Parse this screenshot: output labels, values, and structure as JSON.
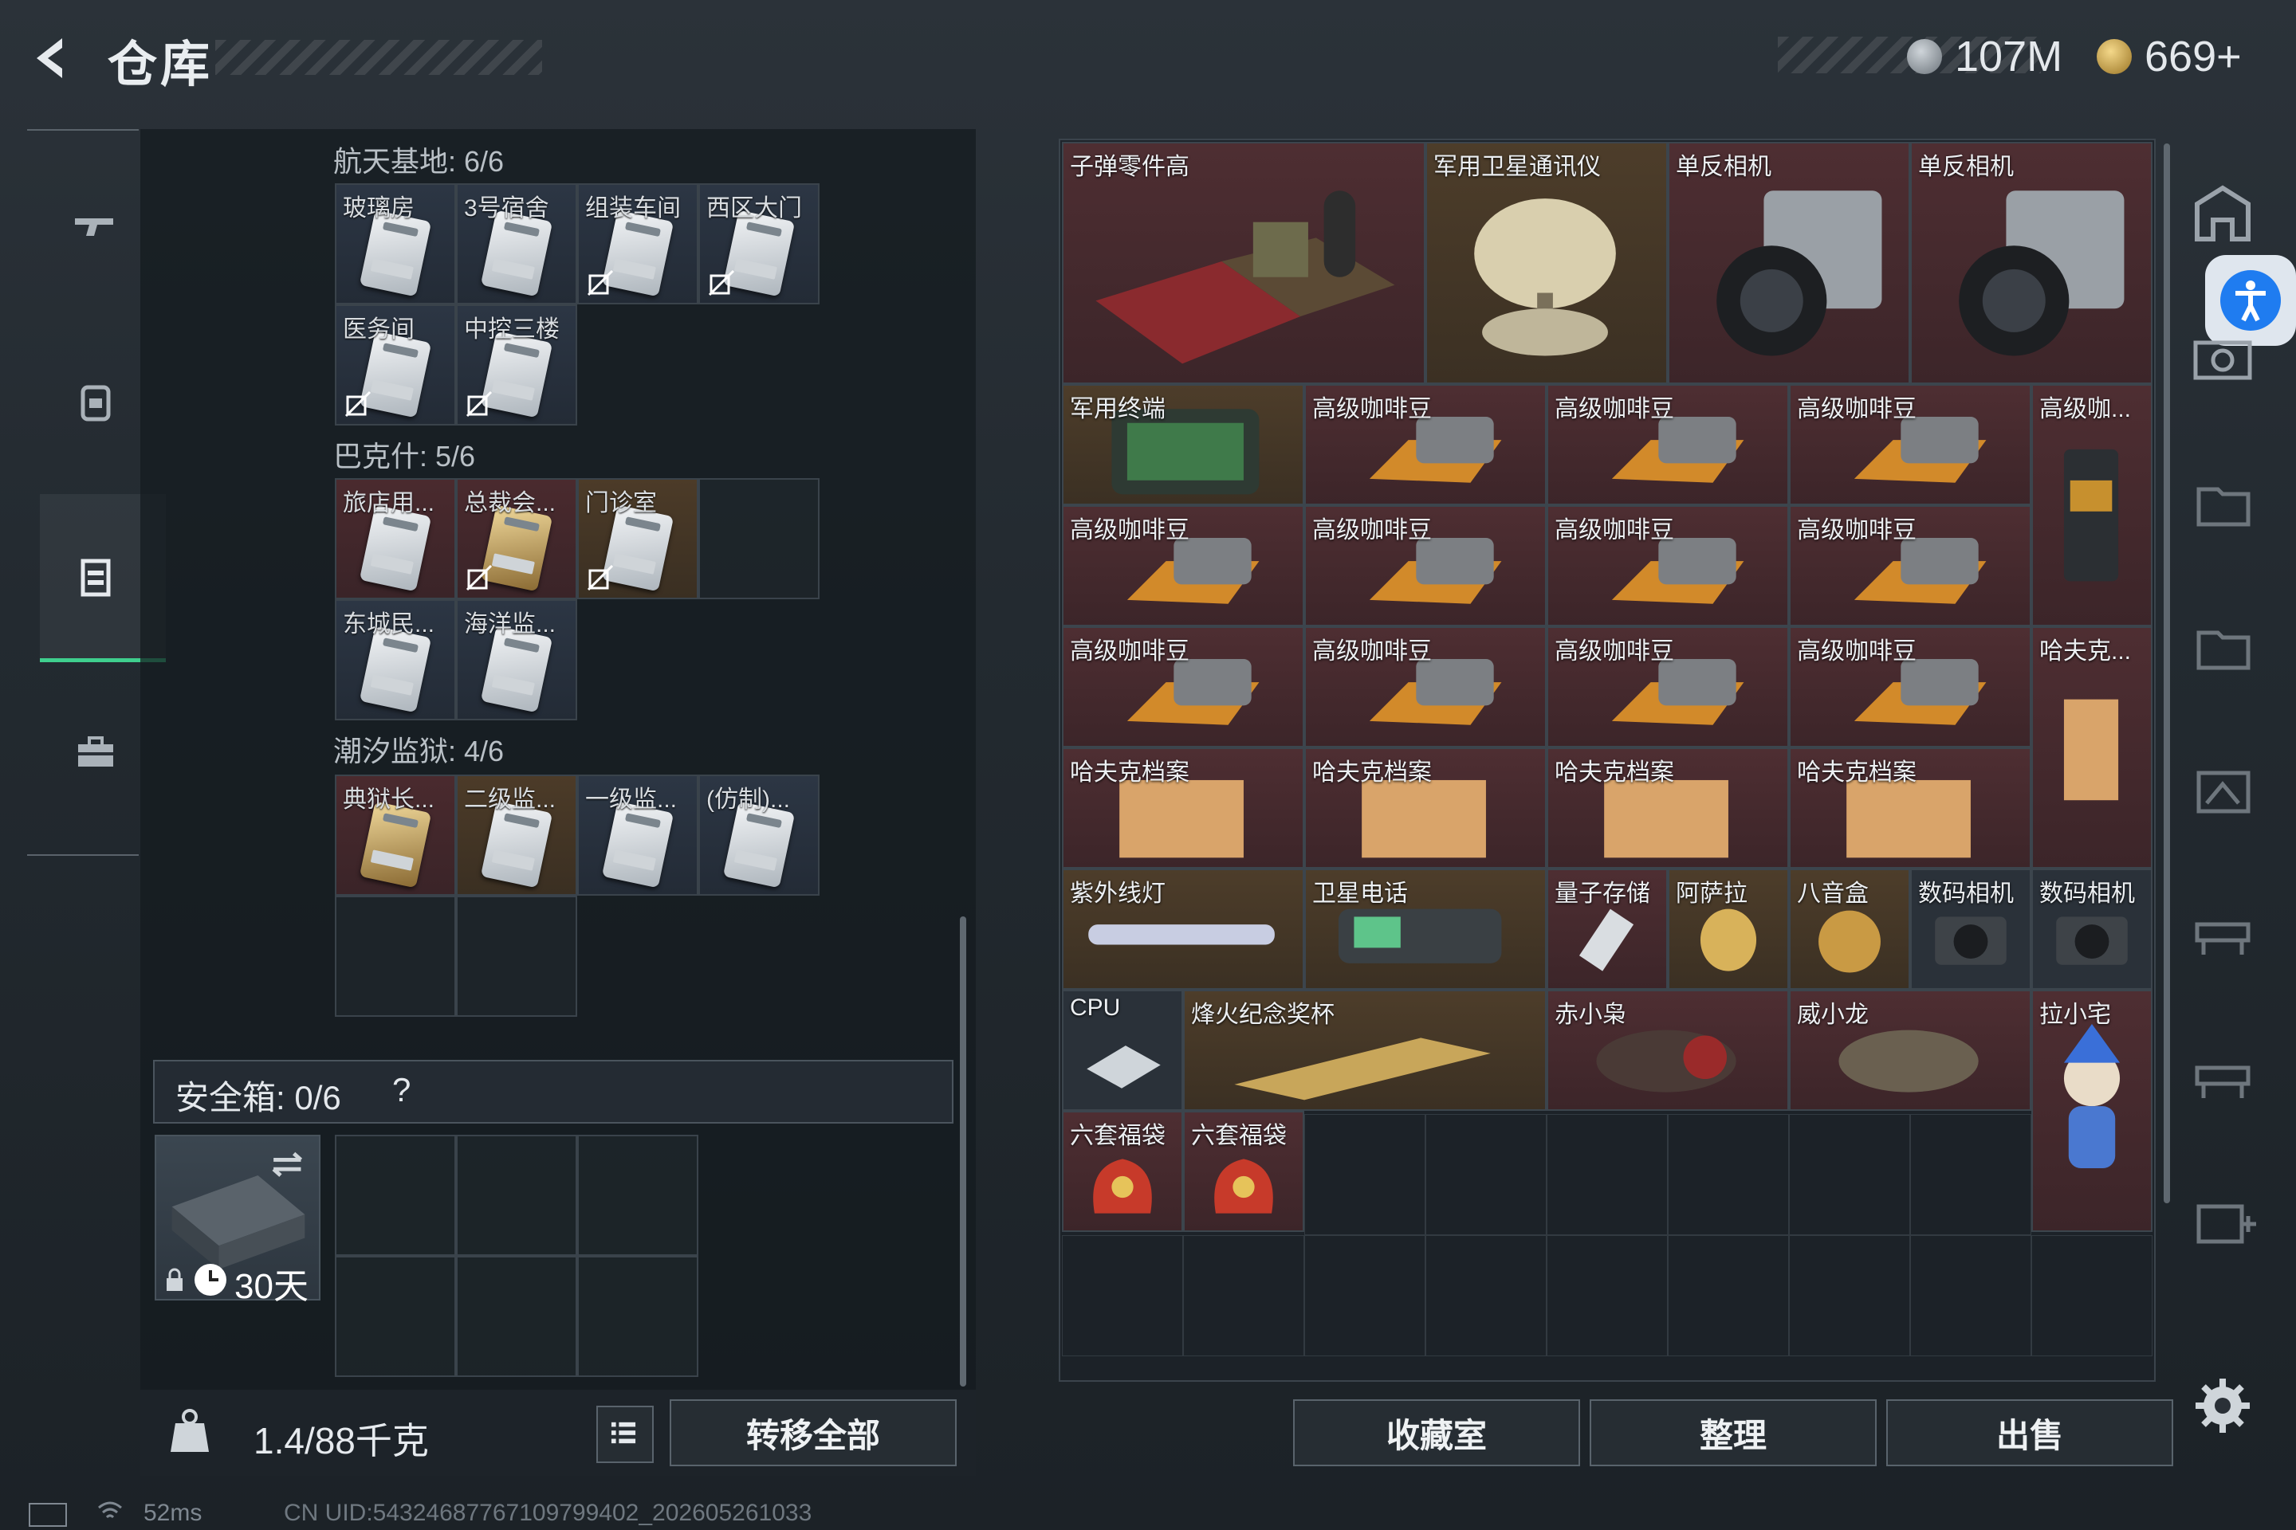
{
  "header": {
    "title": "仓库",
    "currency1": "107M",
    "currency2": "669+"
  },
  "colors": {
    "accent": "#3fcf8e",
    "red_rarity": "#4e2e32",
    "gold_rarity": "#4d3d2a"
  },
  "left_nav": {
    "items": [
      "gun-icon",
      "backpack-icon",
      "vest-icon",
      "briefcase-icon"
    ],
    "selected": "vest-icon"
  },
  "groups": [
    {
      "title": "航天基地: 6/6",
      "items": [
        "玻璃房",
        "3号宿舍",
        "组装车间",
        "西区大门",
        "医务间",
        "中控三楼"
      ]
    },
    {
      "title": "巴克什: 5/6",
      "items": [
        "旅店用...",
        "总裁会...",
        "门诊室",
        "东城民...",
        "海洋监..."
      ]
    },
    {
      "title": "潮汐监狱: 4/6",
      "items": [
        "典狱长...",
        "二级监...",
        "一级监...",
        "(仿制)..."
      ]
    }
  ],
  "safe": {
    "label": "安全箱: 0/6",
    "help": "?",
    "days": "30天"
  },
  "bottom": {
    "weight": "1.4/88千克",
    "transfer": "转移全部",
    "collection": "收藏室",
    "organize": "整理",
    "sell": "出售"
  },
  "stash_items": {
    "bullet": "子弹零件高",
    "satcom": "军用卫星通讯仪",
    "slr1": "单反相机",
    "slr2": "单反相机",
    "terminal": "军用终端",
    "coffee": "高级咖啡豆",
    "coffee_tall": "高级咖...",
    "harfk_tall": "哈夫克...",
    "harfk": "哈夫克档案",
    "uv": "紫外线灯",
    "satphone": "卫星电话",
    "quantum": "量子存储",
    "asala": "阿萨拉",
    "music": "八音盒",
    "digicam1": "数码相机",
    "digicam2": "数码相机",
    "cpu": "CPU",
    "trophy": "烽火纪念奖杯",
    "chixiao": "赤小枭",
    "weixiao": "威小龙",
    "laxiao": "拉小宅",
    "bag1": "六套福袋",
    "bag2": "六套福袋"
  },
  "right_nav": [
    "home-icon",
    "accessibility-icon",
    "camera-icon",
    "folder-IV-icon",
    "folder-IV-icon",
    "chart-IV-icon",
    "rack-III-icon",
    "rack-III-icon",
    "plus-IV-icon",
    "gear-icon"
  ],
  "status": {
    "ping": "52ms",
    "uid": "CN UID:54324687767109799402_202605261033"
  }
}
